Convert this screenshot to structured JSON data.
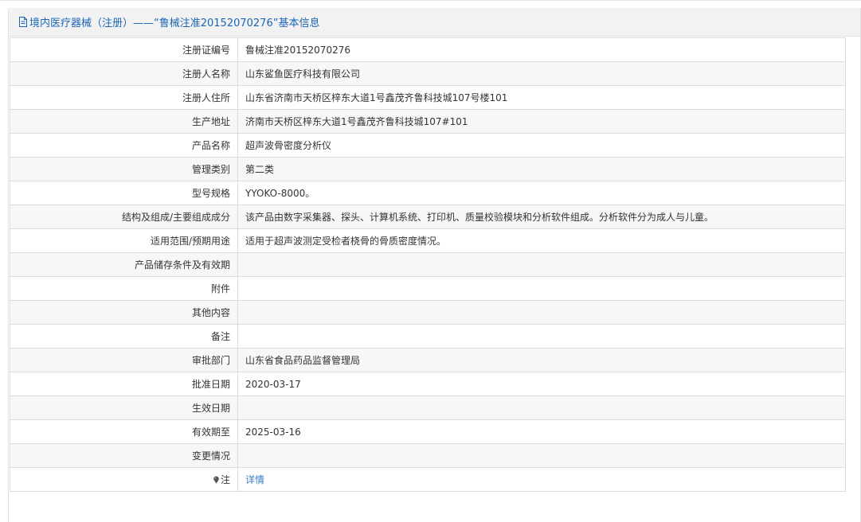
{
  "header": {
    "title": "境内医疗器械（注册）——“鲁械注准20152070276”基本信息",
    "icon": "document-icon"
  },
  "rows": [
    {
      "label": "注册证编号",
      "value": "鲁械注准20152070276"
    },
    {
      "label": "注册人名称",
      "value": "山东鲨鱼医疗科技有限公司"
    },
    {
      "label": "注册人住所",
      "value": "山东省济南市天桥区梓东大道1号鑫茂齐鲁科技城107号楼101"
    },
    {
      "label": "生产地址",
      "value": "济南市天桥区梓东大道1号鑫茂齐鲁科技城107#101"
    },
    {
      "label": "产品名称",
      "value": "超声波骨密度分析仪"
    },
    {
      "label": "管理类别",
      "value": "第二类"
    },
    {
      "label": "型号规格",
      "value": "YYOKO-8000。"
    },
    {
      "label": "结构及组成/主要组成成分",
      "value": "该产品由数字采集器、探头、计算机系统、打印机、质量校验模块和分析软件组成。分析软件分为成人与儿童。"
    },
    {
      "label": "适用范围/预期用途",
      "value": "适用于超声波测定受检者桡骨的骨质密度情况。"
    },
    {
      "label": "产品储存条件及有效期",
      "value": ""
    },
    {
      "label": "附件",
      "value": ""
    },
    {
      "label": "其他内容",
      "value": ""
    },
    {
      "label": "备注",
      "value": ""
    },
    {
      "label": "审批部门",
      "value": "山东省食品药品监督管理局"
    },
    {
      "label": "批准日期",
      "value": "2020-03-17"
    },
    {
      "label": "生效日期",
      "value": ""
    },
    {
      "label": "有效期至",
      "value": "2025-03-16"
    },
    {
      "label": "变更情况",
      "value": ""
    }
  ],
  "note_row": {
    "label": "注",
    "icon": "pin-icon",
    "link_text": "详情"
  },
  "colors": {
    "header_text": "#1a66b5",
    "link": "#3b7cc4",
    "border": "#dcdcdc",
    "stripe": "#f7f7f7"
  }
}
